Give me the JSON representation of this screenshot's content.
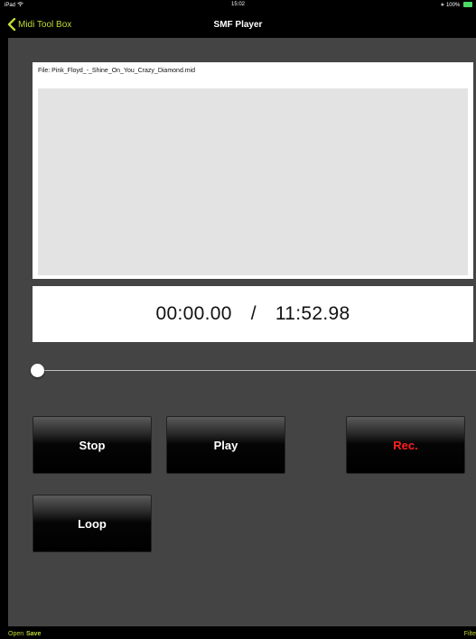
{
  "status_bar": {
    "device": "iPad",
    "time": "15:02",
    "battery": "100%"
  },
  "nav": {
    "back_label": "Midi Tool Box",
    "title": "SMF Player"
  },
  "player": {
    "file_label": "File: Pink_Floyd_-_Shine_On_You_Crazy_Diamond.mid",
    "position": "00:00.00",
    "separator": "/",
    "duration": "11:52.98",
    "progress": 0
  },
  "buttons": {
    "stop": "Stop",
    "play": "Play",
    "rec": "Rec.",
    "loop": "Loop"
  },
  "bottom_bar": {
    "open": "Open",
    "save": "Save",
    "filter": "Filte"
  },
  "colors": {
    "accent": "#c3d934",
    "rec": "#ff2020",
    "battery": "#4cd964",
    "panel": "#444444"
  }
}
